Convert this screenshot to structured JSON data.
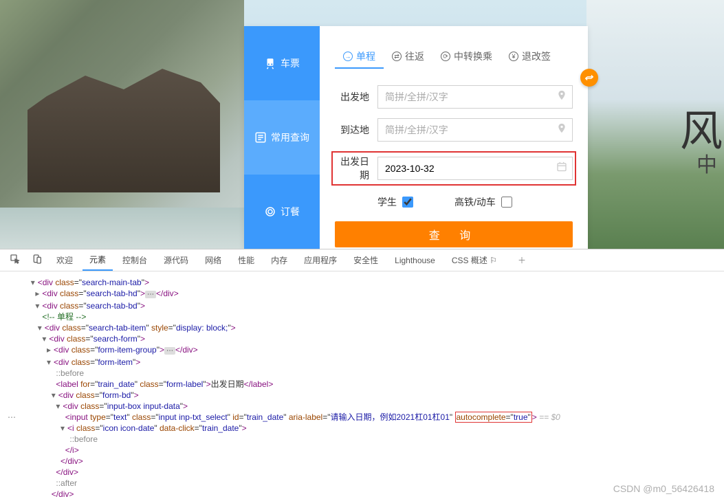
{
  "sidebar": {
    "items": [
      {
        "label": "车票",
        "icon": "train-icon"
      },
      {
        "label": "常用查询",
        "icon": "list-icon"
      },
      {
        "label": "订餐",
        "icon": "meal-icon"
      }
    ]
  },
  "tabs": [
    {
      "label": "单程",
      "icon_char": "→"
    },
    {
      "label": "往返",
      "icon_char": "⇄"
    },
    {
      "label": "中转换乘",
      "icon_char": "⟳"
    },
    {
      "label": "退改签",
      "icon_char": "¥"
    }
  ],
  "form": {
    "from_label": "出发地",
    "from_placeholder": "简拼/全拼/汉字",
    "to_label": "到达地",
    "to_placeholder": "简拼/全拼/汉字",
    "date_label": "出发日期",
    "date_value": "2023-10-32",
    "student_label": "学生",
    "student_checked": true,
    "highspeed_label": "高铁/动车",
    "highspeed_checked": false,
    "search_btn": "查   询"
  },
  "bg": {
    "right_char": "风",
    "right_sub": "中"
  },
  "devtools": {
    "tabs": [
      "欢迎",
      "元素",
      "控制台",
      "源代码",
      "网络",
      "性能",
      "内存",
      "应用程序",
      "安全性",
      "Lighthouse",
      "CSS 概述 ⚐"
    ],
    "active_tab": "元素",
    "dom": {
      "l1": "<div class=\"search-main-tab\">",
      "l2": "<div class=\"search-tab-hd\">…</div>",
      "l3": "<div class=\"search-tab-bd\">",
      "l4": "<!-- 单程 -->",
      "l5": "<div class=\"search-tab-item\" style=\"display: block;\">",
      "l6": "<div class=\"search-form\">",
      "l7": "<div class=\"form-item-group\">…</div>",
      "l8": "<div class=\"form-item\">",
      "l9": "::before",
      "l10": "<label for=\"train_date\" class=\"form-label\">出发日期</label>",
      "l11": "<div class=\"form-bd\">",
      "l12": "<div class=\"input-box input-data\">",
      "l13_pre": "<input type=\"text\" class=\"input inp-txt_select\" id=\"train_date\" aria-label=\"请输入日期，例如2021杠01杠01\"",
      "l13_hl": "autocomplete=\"true\"",
      "l13_end": "> == $0",
      "l14": "<i class=\"icon icon-date\" data-click=\"train_date\">",
      "l15": "::before",
      "l16": "</i>",
      "l17": "</div>",
      "l18": "</div>",
      "l19": "::after",
      "l20": "</div>"
    }
  },
  "watermark": "CSDN @m0_56426418"
}
